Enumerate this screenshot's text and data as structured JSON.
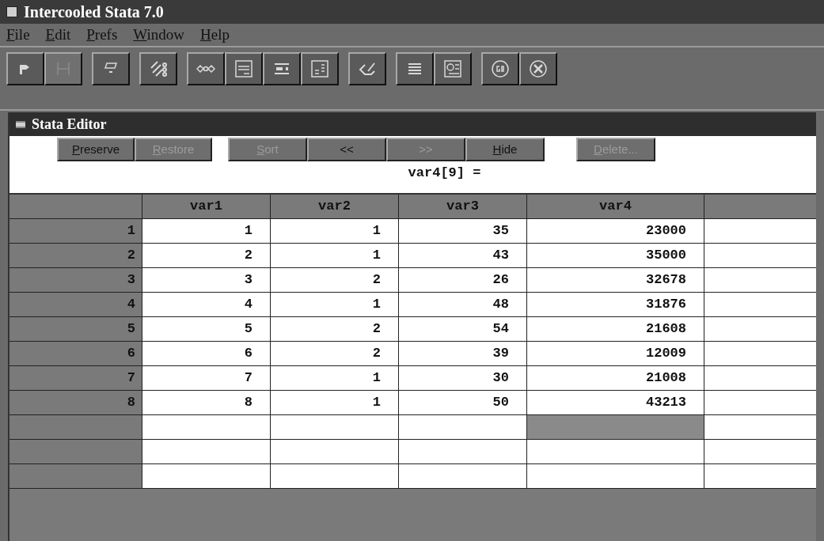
{
  "window": {
    "title": "Intercooled Stata 7.0"
  },
  "menu": [
    {
      "accel": "F",
      "rest": "ile"
    },
    {
      "accel": "E",
      "rest": "dit"
    },
    {
      "accel": "P",
      "rest": "refs"
    },
    {
      "accel": "W",
      "rest": "indow"
    },
    {
      "accel": "H",
      "rest": "elp"
    }
  ],
  "toolbar": [
    {
      "kind": "log",
      "disabled": false
    },
    {
      "kind": "viewer",
      "disabled": true
    },
    {
      "kind": "results",
      "disabled": false
    },
    {
      "kind": "graph",
      "disabled": false
    },
    {
      "kind": "dofile",
      "disabled": false
    },
    {
      "kind": "editor",
      "disabled": false
    },
    {
      "kind": "browser",
      "disabled": false
    },
    {
      "kind": "variables",
      "disabled": false
    },
    {
      "kind": "clear",
      "disabled": false
    },
    {
      "kind": "data",
      "disabled": false
    },
    {
      "kind": "browse",
      "disabled": false
    },
    {
      "kind": "go",
      "disabled": false
    },
    {
      "kind": "break",
      "disabled": false
    }
  ],
  "editor": {
    "title": "Stata Editor",
    "buttons": [
      {
        "accel": "P",
        "rest": "reserve",
        "disabled": false
      },
      {
        "accel": "R",
        "rest": "estore",
        "disabled": true
      },
      {
        "accel": "S",
        "rest": "ort",
        "disabled": true
      },
      {
        "rest": "<<",
        "disabled": false
      },
      {
        "rest": ">>",
        "disabled": true
      },
      {
        "accel": "H",
        "rest": "ide",
        "disabled": false
      },
      {
        "accel": "D",
        "rest": "elete...",
        "disabled": true
      }
    ],
    "cell_reference": "var4[9] =",
    "columns": [
      "var1",
      "var2",
      "var3",
      "var4"
    ],
    "rows": [
      {
        "number": "1",
        "cells": [
          {
            "text": "1",
            "selected": false
          },
          {
            "text": "1",
            "selected": false
          },
          {
            "text": "35",
            "selected": false
          },
          {
            "text": "23000",
            "selected": false
          }
        ]
      },
      {
        "number": "2",
        "cells": [
          {
            "text": "2",
            "selected": false
          },
          {
            "text": "1",
            "selected": false
          },
          {
            "text": "43",
            "selected": false
          },
          {
            "text": "35000",
            "selected": false
          }
        ]
      },
      {
        "number": "3",
        "cells": [
          {
            "text": "3",
            "selected": false
          },
          {
            "text": "2",
            "selected": false
          },
          {
            "text": "26",
            "selected": false
          },
          {
            "text": "32678",
            "selected": false
          }
        ]
      },
      {
        "number": "4",
        "cells": [
          {
            "text": "4",
            "selected": false
          },
          {
            "text": "1",
            "selected": false
          },
          {
            "text": "48",
            "selected": false
          },
          {
            "text": "31876",
            "selected": false
          }
        ]
      },
      {
        "number": "5",
        "cells": [
          {
            "text": "5",
            "selected": false
          },
          {
            "text": "2",
            "selected": false
          },
          {
            "text": "54",
            "selected": false
          },
          {
            "text": "21608",
            "selected": false
          }
        ]
      },
      {
        "number": "6",
        "cells": [
          {
            "text": "6",
            "selected": false
          },
          {
            "text": "2",
            "selected": false
          },
          {
            "text": "39",
            "selected": false
          },
          {
            "text": "12009",
            "selected": false
          }
        ]
      },
      {
        "number": "7",
        "cells": [
          {
            "text": "7",
            "selected": false
          },
          {
            "text": "1",
            "selected": false
          },
          {
            "text": "30",
            "selected": false
          },
          {
            "text": "21008",
            "selected": false
          }
        ]
      },
      {
        "number": "8",
        "cells": [
          {
            "text": "8",
            "selected": false
          },
          {
            "text": "1",
            "selected": false
          },
          {
            "text": "50",
            "selected": false
          },
          {
            "text": "43213",
            "selected": false
          }
        ]
      },
      {
        "cells": [
          {
            "selected": false
          },
          {
            "selected": false
          },
          {
            "selected": false
          },
          {
            "selected": true
          }
        ]
      },
      {
        "cells": [
          {
            "selected": false
          },
          {
            "selected": false
          },
          {
            "selected": false
          },
          {
            "selected": false
          }
        ]
      },
      {
        "cells": [
          {
            "selected": false
          },
          {
            "selected": false
          },
          {
            "selected": false
          },
          {
            "selected": false
          }
        ]
      }
    ]
  }
}
